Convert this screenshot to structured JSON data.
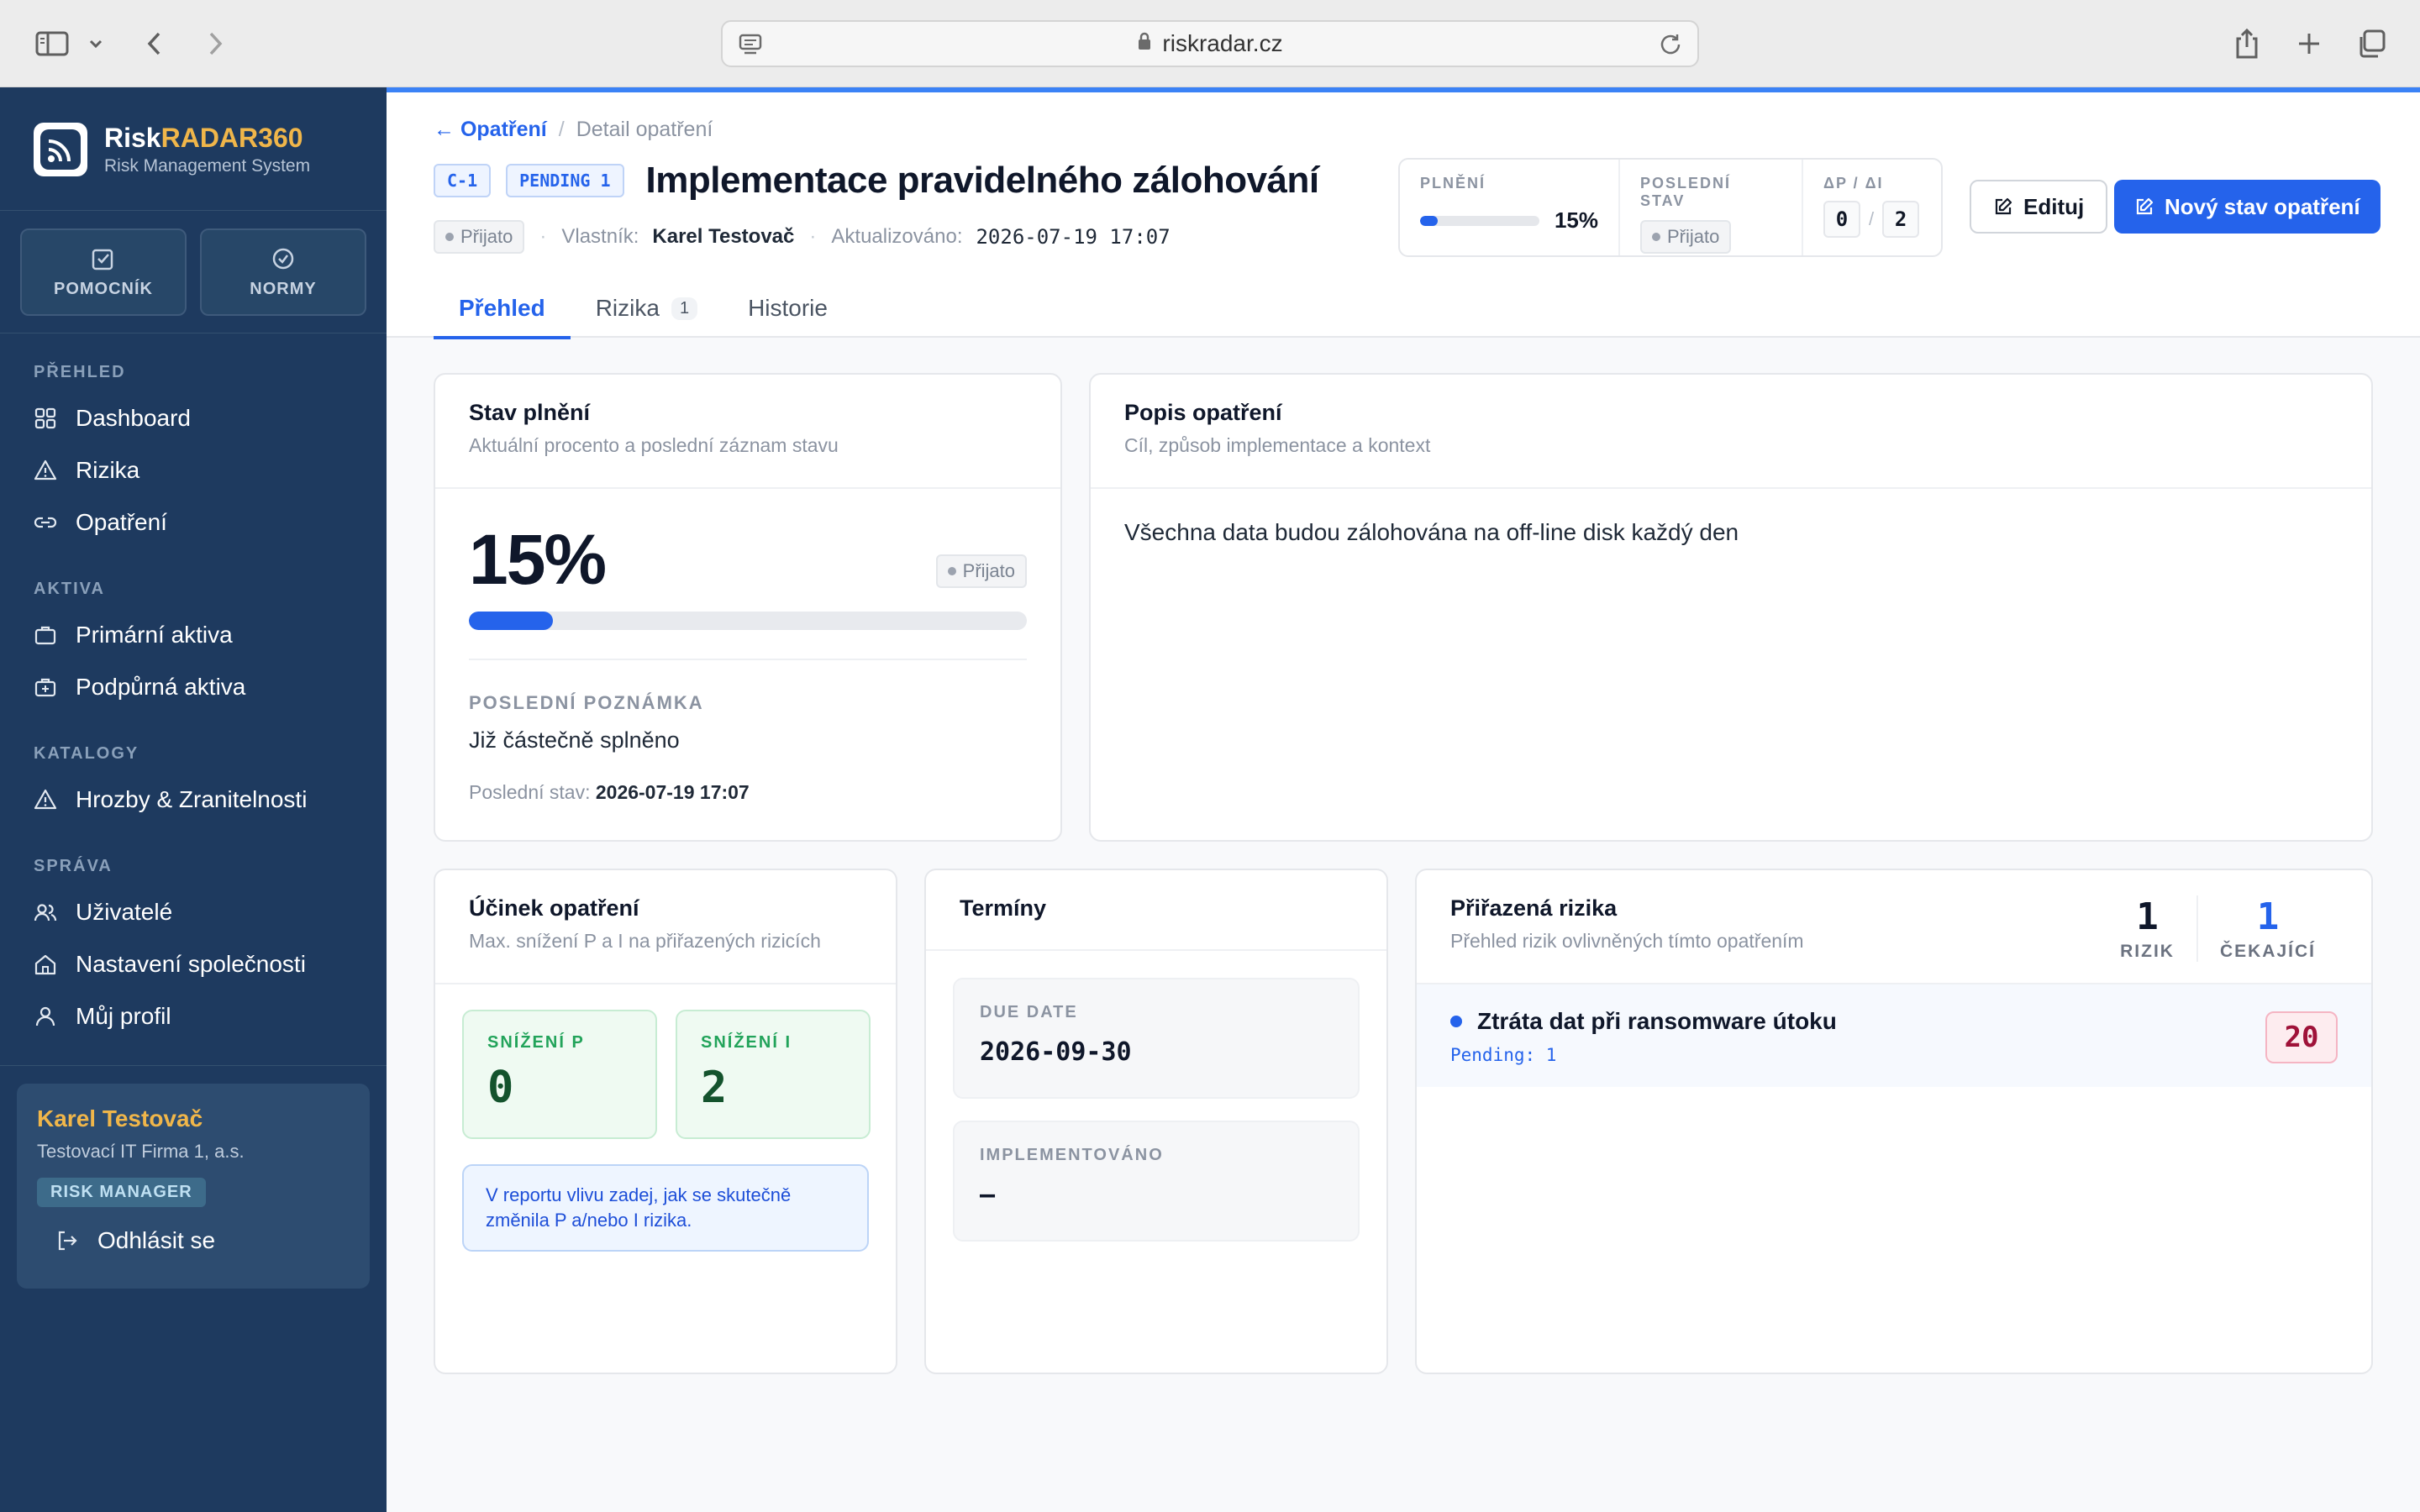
{
  "browser": {
    "url": "riskradar.cz"
  },
  "brand": {
    "name_part1": "Risk",
    "name_part2": "RADAR360",
    "subtitle": "Risk Management System"
  },
  "quick_actions": [
    {
      "label": "POMOCNÍK",
      "icon": "edit-check-icon"
    },
    {
      "label": "NORMY",
      "icon": "circle-check-icon"
    }
  ],
  "sidebar": {
    "sections": [
      {
        "title": "PŘEHLED",
        "items": [
          {
            "label": "Dashboard",
            "icon": "grid-icon"
          },
          {
            "label": "Rizika",
            "icon": "warning-triangle-icon"
          },
          {
            "label": "Opatření",
            "icon": "link-icon"
          }
        ]
      },
      {
        "title": "AKTIVA",
        "items": [
          {
            "label": "Primární aktiva",
            "icon": "briefcase-icon"
          },
          {
            "label": "Podpůrná aktiva",
            "icon": "briefcase-plus-icon"
          }
        ]
      },
      {
        "title": "KATALOGY",
        "items": [
          {
            "label": "Hrozby & Zranitelnosti",
            "icon": "warning-triangle-icon"
          }
        ]
      },
      {
        "title": "SPRÁVA",
        "items": [
          {
            "label": "Uživatelé",
            "icon": "users-icon"
          },
          {
            "label": "Nastavení společnosti",
            "icon": "home-icon"
          },
          {
            "label": "Můj profil",
            "icon": "user-icon"
          }
        ]
      }
    ]
  },
  "user": {
    "name": "Karel Testovač",
    "company": "Testovací IT Firma 1, a.s.",
    "role": "RISK MANAGER",
    "logout": "Odhlásit se"
  },
  "breadcrumb": {
    "back": "← Opatření",
    "separator": "/",
    "current": "Detail opatření"
  },
  "header": {
    "code": "C-1",
    "pending": "PENDING 1",
    "title": "Implementace pravidelného zálohování",
    "status": "Přijato",
    "owner_label": "Vlastník:",
    "owner": "Karel Testovač",
    "updated_label": "Aktualizováno:",
    "updated": "2026-07-19 17:07"
  },
  "summary": {
    "fulfillment_label": "PLNĚNÍ",
    "fulfillment_pct": "15%",
    "fulfillment_fraction": 0.15,
    "last_status_label": "POSLEDNÍ STAV",
    "last_status": "Přijato",
    "delta_label": "ΔP / ΔI",
    "delta_p": "0",
    "delta_sep": "/",
    "delta_i": "2"
  },
  "actions": {
    "edit": "Edituj",
    "new_status": "Nový stav opatření"
  },
  "tabs": [
    {
      "label": "Přehled",
      "active": true
    },
    {
      "label": "Rizika",
      "count": "1"
    },
    {
      "label": "Historie"
    }
  ],
  "status_card": {
    "title": "Stav plnění",
    "subtitle": "Aktuální procento a poslední záznam stavu",
    "pct": "15%",
    "fraction": 0.15,
    "status": "Přijato",
    "note_label": "POSLEDNÍ POZNÁMKA",
    "note": "Již částečně splněno",
    "last_status_label": "Poslední stav:",
    "last_status_time": "2026-07-19 17:07"
  },
  "desc_card": {
    "title": "Popis opatření",
    "subtitle": "Cíl, způsob implementace a kontext",
    "text": "Všechna data budou zálohována na off-line disk každý den"
  },
  "effect_card": {
    "title": "Účinek opatření",
    "subtitle": "Max. snížení P a I na přiřazených rizicích",
    "p_label": "SNÍŽENÍ P",
    "p_value": "0",
    "i_label": "SNÍŽENÍ I",
    "i_value": "2",
    "hint": "V reportu vlivu zadej, jak se skutečně změnila P a/nebo I rizika."
  },
  "terms_card": {
    "title": "Termíny",
    "due_label": "DUE DATE",
    "due_value": "2026-09-30",
    "impl_label": "IMPLEMENTOVÁNO",
    "impl_value": "–"
  },
  "risks_card": {
    "title": "Přiřazená rizika",
    "subtitle": "Přehled rizik ovlivněných tímto opatřením",
    "risk_count": "1",
    "risk_label": "RIZIK",
    "pending_count": "1",
    "pending_label": "ČEKAJÍCÍ",
    "items": [
      {
        "name": "Ztráta dat při ransomware útoku",
        "pending": "Pending: 1",
        "score": "20"
      }
    ]
  },
  "colors": {
    "sidebar_bg": "#1e3a5f",
    "accent": "#2563eb",
    "brand_accent": "#f0b64a"
  }
}
